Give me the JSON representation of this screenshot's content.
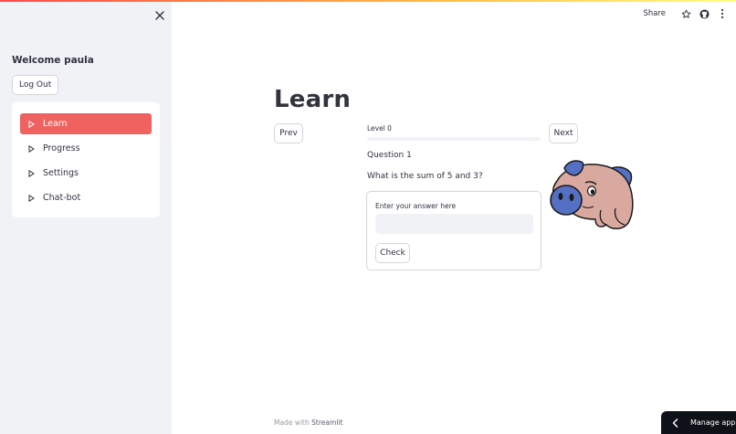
{
  "sidebar": {
    "welcome": "Welcome paula",
    "logout_label": "Log Out",
    "nav": [
      {
        "label": "Learn",
        "active": true
      },
      {
        "label": "Progress",
        "active": false
      },
      {
        "label": "Settings",
        "active": false
      },
      {
        "label": "Chat-bot",
        "active": false
      }
    ]
  },
  "header": {
    "share_label": "Share",
    "icons": [
      "star-icon",
      "github-icon",
      "more-vertical-icon"
    ]
  },
  "main": {
    "title": "Learn",
    "prev_label": "Prev",
    "next_label": "Next",
    "level_label": "Level 0",
    "progress_fraction": 0,
    "question_title": "Question 1",
    "question_text": "What is the sum of 5 and 3?",
    "answer_label": "Enter your answer here",
    "answer_value": "",
    "check_label": "Check"
  },
  "footer": {
    "made_with": "Made with",
    "brand": "Streamlit"
  },
  "manage_app": {
    "label": "Manage app"
  },
  "colors": {
    "accent": "#ff4b4b",
    "active_nav": "#f0625f",
    "sidebar_bg": "#f0f2f6",
    "pig_body": "#d9a9a0",
    "pig_ears": "#5470c4",
    "manage_bg": "#0e1117"
  }
}
